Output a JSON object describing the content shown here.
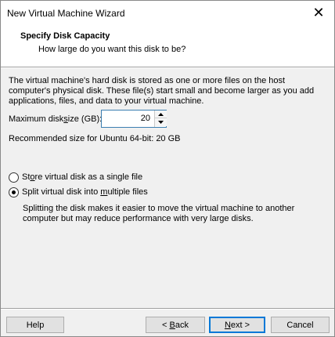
{
  "window": {
    "title": "New Virtual Machine Wizard",
    "close_glyph": "✕"
  },
  "header": {
    "title": "Specify Disk Capacity",
    "subtitle": "How large do you want this disk to be?"
  },
  "description": "The virtual machine's hard disk is stored as one or more files on the host computer's physical disk. These file(s) start small and become larger as you add applications, files, and data to your virtual machine.",
  "disk_size": {
    "label_pre": "Maximum disk ",
    "label_u": "s",
    "label_post": "ize (GB):",
    "value": "20"
  },
  "recommended": "Recommended size for Ubuntu 64-bit: 20 GB",
  "options": {
    "single": {
      "pre": "St",
      "u": "o",
      "post": "re virtual disk as a single file",
      "checked": false
    },
    "split": {
      "pre": "Split virtual disk into ",
      "u": "m",
      "post": "ultiple files",
      "checked": true
    }
  },
  "split_description": "Splitting the disk makes it easier to move the virtual machine to another computer but may reduce performance with very large disks.",
  "buttons": {
    "help": "Help",
    "back_pre": "< ",
    "back_u": "B",
    "back_post": "ack",
    "next_u": "N",
    "next_post": "ext >",
    "cancel": "Cancel"
  },
  "colors": {
    "accent": "#0078d7",
    "dialog_bg": "#f0f0f0"
  }
}
